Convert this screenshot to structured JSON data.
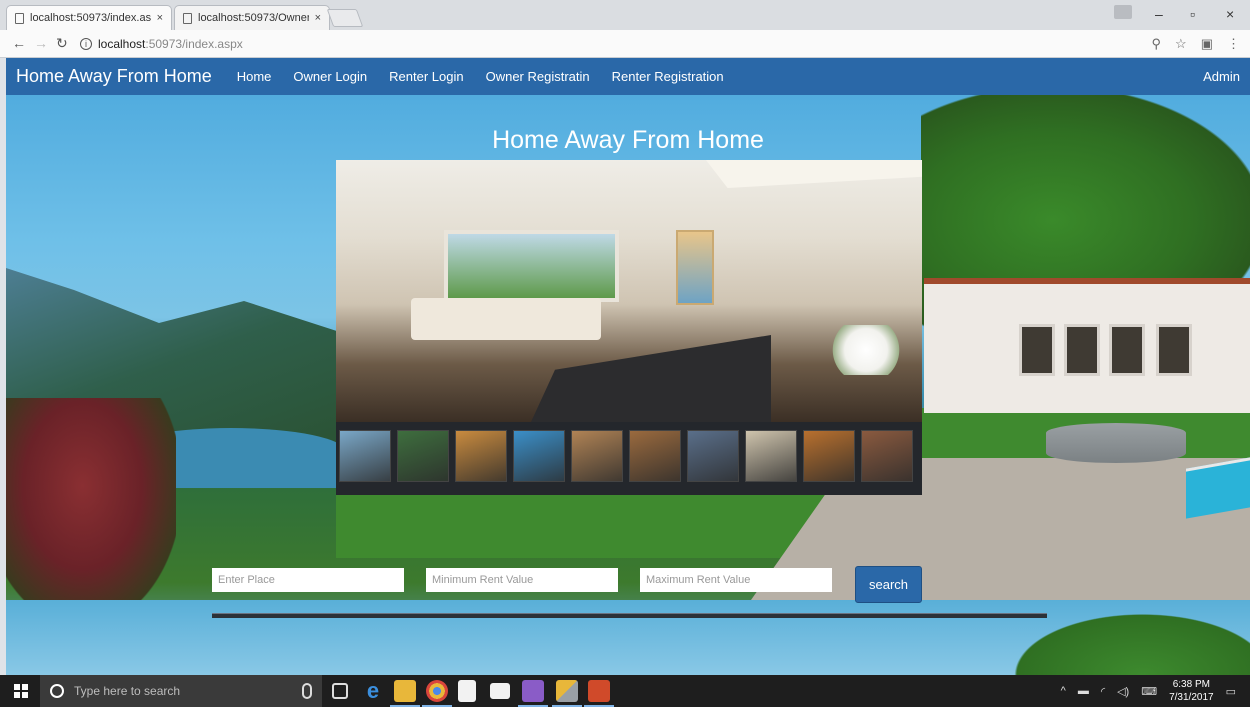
{
  "browser": {
    "tabs": [
      {
        "title": "localhost:50973/index.as",
        "active": true
      },
      {
        "title": "localhost:50973/Owner",
        "active": false
      }
    ],
    "address": {
      "host": "localhost",
      "path": ":50973/index.aspx"
    }
  },
  "navbar": {
    "brand": "Home Away From Home",
    "links": [
      "Home",
      "Owner Login",
      "Renter Login",
      "Owner Registratin",
      "Renter Registration"
    ],
    "admin": "Admin"
  },
  "hero": {
    "title": "Home Away From Home"
  },
  "thumbnails": {
    "count": 10,
    "colors": [
      "#7aa7c7",
      "#3e6e3e",
      "#c98b3f",
      "#3b8fc8",
      "#b08355",
      "#9a6a3e",
      "#5a6f8a",
      "#cfc4ad",
      "#b8702e",
      "#8a5a3f"
    ]
  },
  "search": {
    "place_placeholder": "Enter Place",
    "min_placeholder": "Minimum Rent Value",
    "max_placeholder": "Maximum Rent Value",
    "button_label": "search"
  },
  "taskbar": {
    "search_placeholder": "Type here to search",
    "time": "6:38 PM",
    "date": "7/31/2017"
  }
}
